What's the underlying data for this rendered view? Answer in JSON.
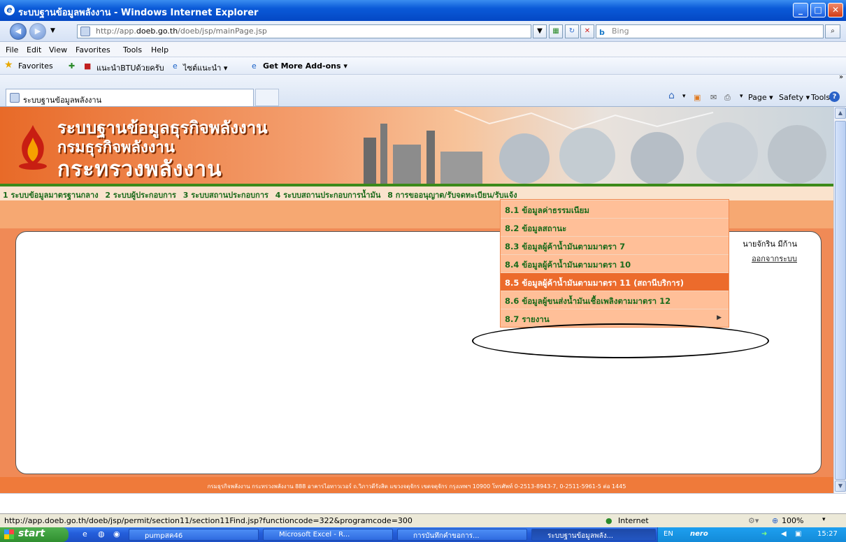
{
  "window": {
    "title": "ระบบฐานข้อมูลพลังงาน - Windows Internet Explorer",
    "buttons": {
      "minimize": "_",
      "maximize": "□",
      "close": "✕"
    }
  },
  "address_bar": {
    "url_prefix": "http://app.",
    "url_domain": "doeb.go.th",
    "url_path": "/doeb/jsp/mainPage.jsp",
    "search_placeholder": "Bing"
  },
  "menu": {
    "items": [
      "File",
      "Edit",
      "View",
      "Favorites",
      "Tools",
      "Help"
    ]
  },
  "favorites_bar": {
    "favorites_label": "Favorites",
    "links": [
      "แนะนำBTUด้วยครับ",
      "ไซต์แนะนำ ▾",
      "Get More Add-ons ▾"
    ]
  },
  "tab": {
    "label": "ระบบฐานข้อมูลพลังงาน"
  },
  "command_bar": {
    "page": "Page ▾",
    "safety": "Safety ▾",
    "tools": "Tools ▾",
    "help": "?",
    "more": "»"
  },
  "header": {
    "line1": "ระบบฐานข้อมูลธุรกิจพลังงาน",
    "line2": "กรมธุรกิจพลังงาน",
    "line3": "กระทรวงพลังงาน"
  },
  "nav": {
    "items": [
      "1 ระบบข้อมูลมาตรฐานกลาง",
      "2 ระบบผู้ประกอบการ",
      "3 ระบบสถานประกอบการ",
      "4 ระบบสถานประกอบการน้ำมัน",
      "8 การขออนุญาต/รับจดทะเบียน/รับแจ้ง"
    ]
  },
  "dropdown": {
    "items": [
      "8.1 ข้อมูลค่าธรรมเนียม",
      "8.2 ข้อมูลสถานะ",
      "8.3 ข้อมูลผู้ค้าน้ำมันตามมาตรา 7",
      "8.4 ข้อมูลผู้ค้าน้ำมันตามมาตรา 10",
      "8.5 ข้อมูลผู้ค้าน้ำมันตามมาตรา 11 (สถานีบริการ)",
      "8.6 ข้อมูลผู้ขนส่งน้ำมันเชื้อเพลิงตามมาตรา 12",
      "8.7 รายงาน"
    ],
    "submenu_arrow": "▶"
  },
  "user": {
    "name": "นายจักริน มีก้าน",
    "logout": "ออกจากระบบ"
  },
  "footer": {
    "text": "กรมธุรกิจพลังงาน กระทรวงพลังงาน 888 อาคารไอทาวเวอร์ ถ.วิภาวดีรังสิต แขวงจตุจักร เขตจตุจักร กรุงเทพฯ 10900 โทรศัพท์ 0-2513-8943-7, 0-2511-5961-5 ต่อ 1445"
  },
  "status_bar": {
    "url": "http://app.doeb.go.th/doeb/jsp/permit/section11/section11Find.jsp?functioncode=322&programcode=300",
    "zone": "Internet",
    "zoom": "100%"
  },
  "taskbar": {
    "start": "start",
    "buttons": [
      "pumpสค46",
      "Microsoft Excel - R...",
      "การบันทึกคำขอการ...",
      "ระบบฐานข้อมูลพลัง..."
    ],
    "lang": "EN",
    "nero": "nero",
    "time": "15:27"
  }
}
